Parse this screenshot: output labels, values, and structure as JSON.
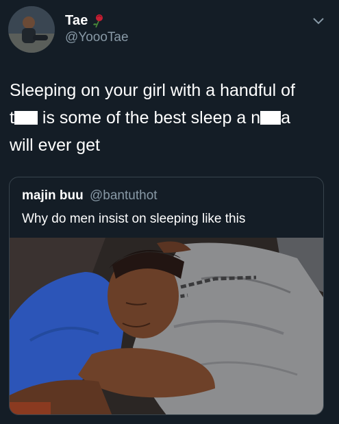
{
  "tweet": {
    "display_name": "Tae",
    "handle": "@YoooTae",
    "text_lines": [
      {
        "before": "Sleeping on your girl with a handful of",
        "after": ""
      },
      {
        "before": "t",
        "after": " is some of the best sleep a n"
      },
      {
        "after2": "a"
      },
      {
        "before": "will ever get",
        "after": ""
      }
    ],
    "line1": "Sleeping on your girl with a handful of",
    "line2_a": "t",
    "line2_b": " is some of the best sleep a n",
    "line2_c": "a",
    "line3": "will ever get"
  },
  "quoted_tweet": {
    "display_name": "majin buu",
    "handle": "@bantuthot",
    "text": "Why do men insist on sleeping like this"
  },
  "icons": {
    "name_emoji": "rose-icon",
    "menu": "chevron-down-icon"
  },
  "colors": {
    "background": "#141d26",
    "secondary_text": "#8899a6",
    "card_border": "#38444d"
  }
}
